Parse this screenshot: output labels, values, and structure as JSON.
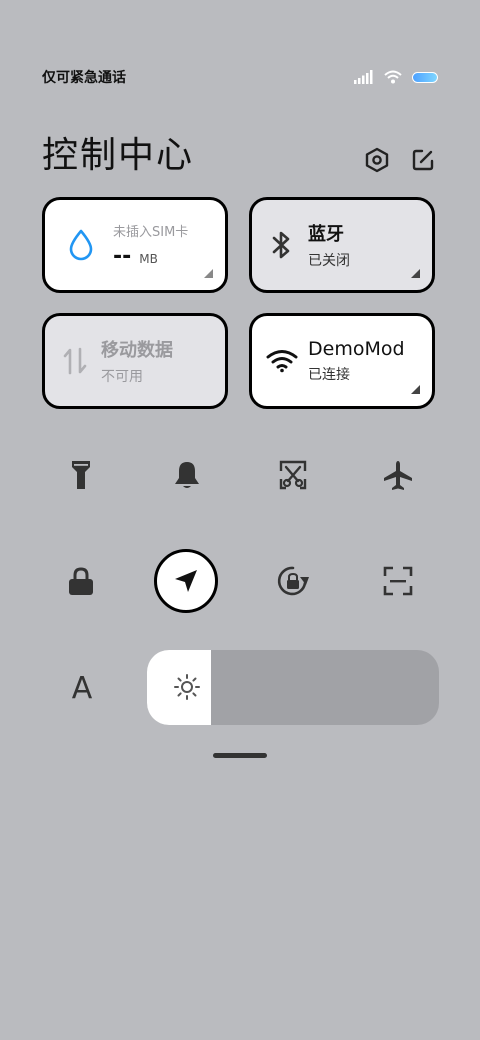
{
  "status_bar": {
    "carrier": "仅可紧急通话",
    "signal_icon": "signal-icon",
    "wifi_icon": "wifi-icon",
    "battery_icon": "battery-icon",
    "battery_color": "#4ea1ff"
  },
  "header": {
    "title": "控制中心",
    "settings_icon": "hexagon-settings-icon",
    "edit_icon": "edit-icon"
  },
  "tiles": {
    "data_usage": {
      "line1": "未插入SIM卡",
      "value": "--",
      "unit": "MB",
      "icon": "water-drop-icon",
      "icon_color": "#2196f3"
    },
    "bluetooth": {
      "title": "蓝牙",
      "status": "已关闭",
      "icon": "bluetooth-icon"
    },
    "mobile_data": {
      "title": "移动数据",
      "status": "不可用",
      "icon": "data-arrows-icon"
    },
    "wifi": {
      "title": "DemoMod",
      "status": "已连接",
      "icon": "wifi-icon"
    }
  },
  "toggles_row1": [
    "flashlight-icon",
    "bell-icon",
    "screenshot-icon",
    "airplane-icon"
  ],
  "toggles_row2": [
    "lock-icon",
    "location-icon",
    "rotation-lock-icon",
    "scan-icon"
  ],
  "font_button": "A",
  "brightness": {
    "level": 0.22,
    "icon": "sun-icon"
  }
}
